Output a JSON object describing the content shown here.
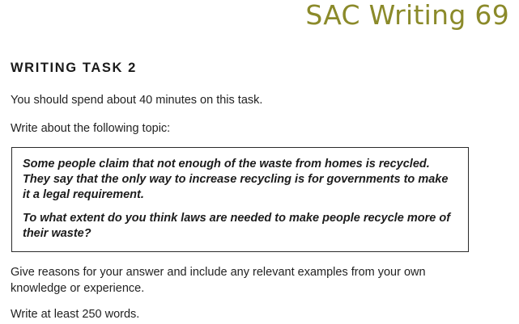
{
  "header": {
    "title": "SAC Writing 69",
    "title_color": "#8b8a2a"
  },
  "task": {
    "heading": "WRITING TASK 2",
    "time_instruction": "You should spend about 40 minutes on this task.",
    "topic_instruction": "Write about the following topic:",
    "prompt": {
      "claim_lines": [
        "Some people claim that not enough of the waste from homes is recycled.",
        "They say that the only way to increase recycling is for governments to make",
        "it a legal requirement."
      ],
      "question_lines": [
        "To what extent do you think laws are needed to make people recycle more of",
        "their waste?"
      ]
    },
    "reasons_lines": [
      "Give reasons for your answer and include any relevant examples from your own",
      "knowledge or experience."
    ],
    "word_requirement": "Write at least 250 words."
  }
}
